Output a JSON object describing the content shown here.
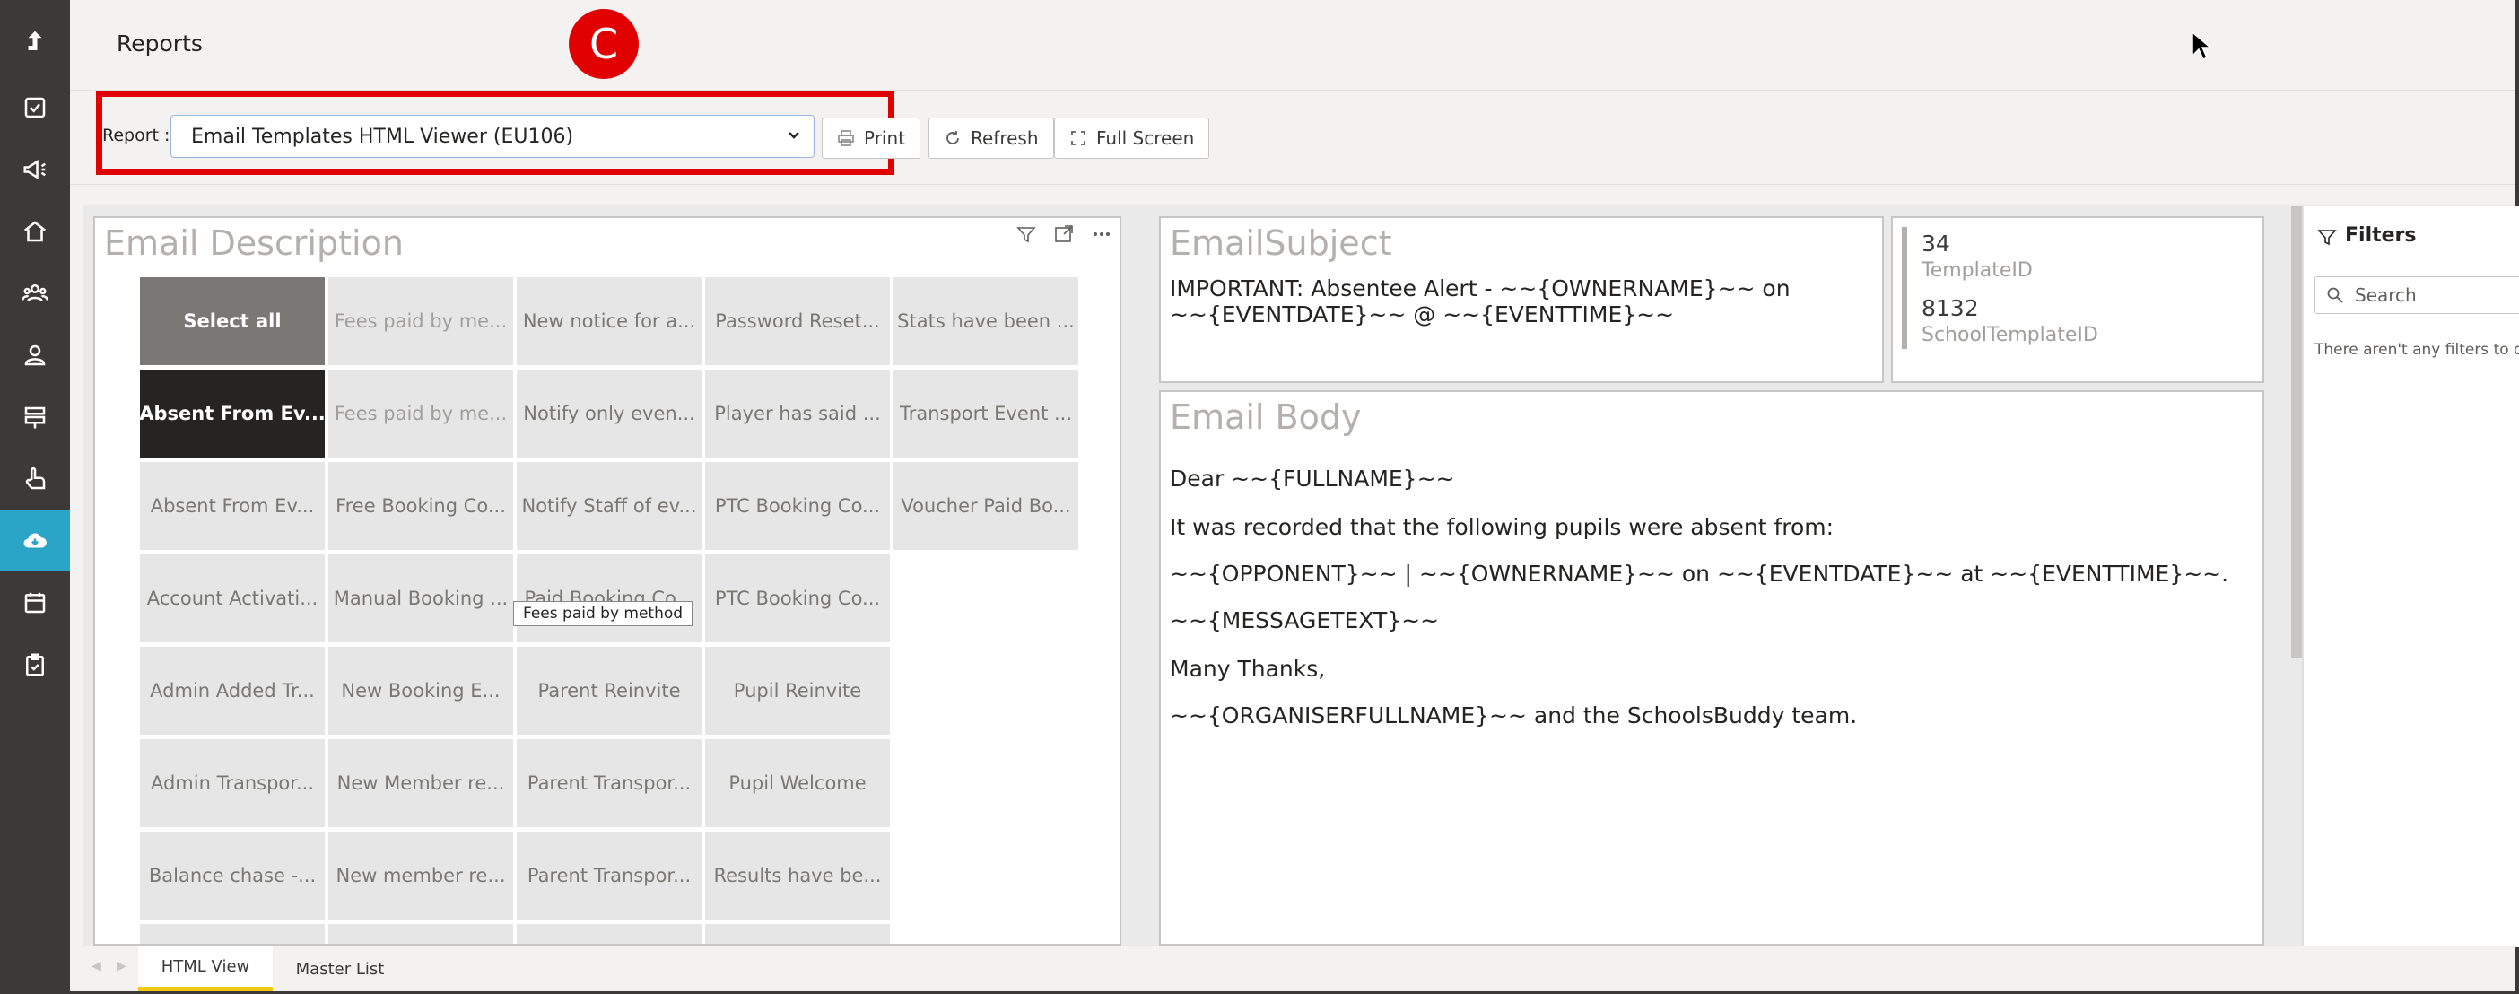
{
  "header": {
    "title": "Reports"
  },
  "annotation": {
    "step_label": "C",
    "accent": "#e00000"
  },
  "toolbar": {
    "report_label": "Report :",
    "report_selected": "Email Templates HTML Viewer (EU106)",
    "print_label": "Print",
    "refresh_label": "Refresh",
    "fullscreen_label": "Full Screen"
  },
  "sidebar": {
    "accent": "#2aa4c7",
    "icons": [
      "exit-icon",
      "checklist-icon",
      "megaphone-icon",
      "home-icon",
      "group-icon",
      "person-icon",
      "signpost-icon",
      "hand-pointer-icon",
      "cloud-download-icon",
      "calendar-icon",
      "clipboard-check-icon"
    ],
    "active_index": 8
  },
  "email_description": {
    "title": "Email Description",
    "tooltip": "Fees paid by method",
    "tiles": [
      [
        "Select all",
        "Fees paid by me...",
        "New notice for a...",
        "Password Reset...",
        "Stats have been ..."
      ],
      [
        "Absent From Ev...",
        "Fees paid by me...",
        "Notify only even...",
        "Player has said ...",
        "Transport Event ..."
      ],
      [
        "Absent From Ev...",
        "Free Booking Co...",
        "Notify Staff of ev...",
        "PTC Booking Co...",
        "Voucher Paid Bo..."
      ],
      [
        "Account Activati...",
        "Manual Booking ...",
        "Paid Booking Co...",
        "PTC Booking Co..."
      ],
      [
        "Admin Added Tr...",
        "New Booking E...",
        "Parent Reinvite",
        "Pupil Reinvite"
      ],
      [
        "Admin Transpor...",
        "New Member re...",
        "Parent Transpor...",
        "Pupil Welcome"
      ],
      [
        "Balance chase -...",
        "New member re...",
        "Parent Transpor...",
        "Results have be..."
      ]
    ]
  },
  "email_subject": {
    "title": "EmailSubject",
    "text": "IMPORTANT: Absentee Alert - ~~{OWNERNAME}~~ on ~~{EVENTDATE}~~ @ ~~{EVENTTIME}~~"
  },
  "ids": {
    "template_id_value": "34",
    "template_id_label": "TemplateID",
    "school_template_id_value": "8132",
    "school_template_id_label": "SchoolTemplateID"
  },
  "email_body": {
    "title": "Email Body",
    "lines": [
      "Dear ~~{FULLNAME}~~",
      "It was recorded that the following pupils were absent from:",
      "~~{OPPONENT}~~ | ~~{OWNERNAME}~~ on ~~{EVENTDATE}~~ at ~~{EVENTTIME}~~.",
      "~~{MESSAGETEXT}~~",
      "Many Thanks,",
      "~~{ORGANISERFULLNAME}~~ and the SchoolsBuddy team."
    ]
  },
  "filters": {
    "title": "Filters",
    "search_placeholder": "Search",
    "empty_text": "There aren't any filters to display."
  },
  "tabs": {
    "items": [
      "HTML View",
      "Master List"
    ],
    "active": 0,
    "active_color": "#f2c811"
  }
}
